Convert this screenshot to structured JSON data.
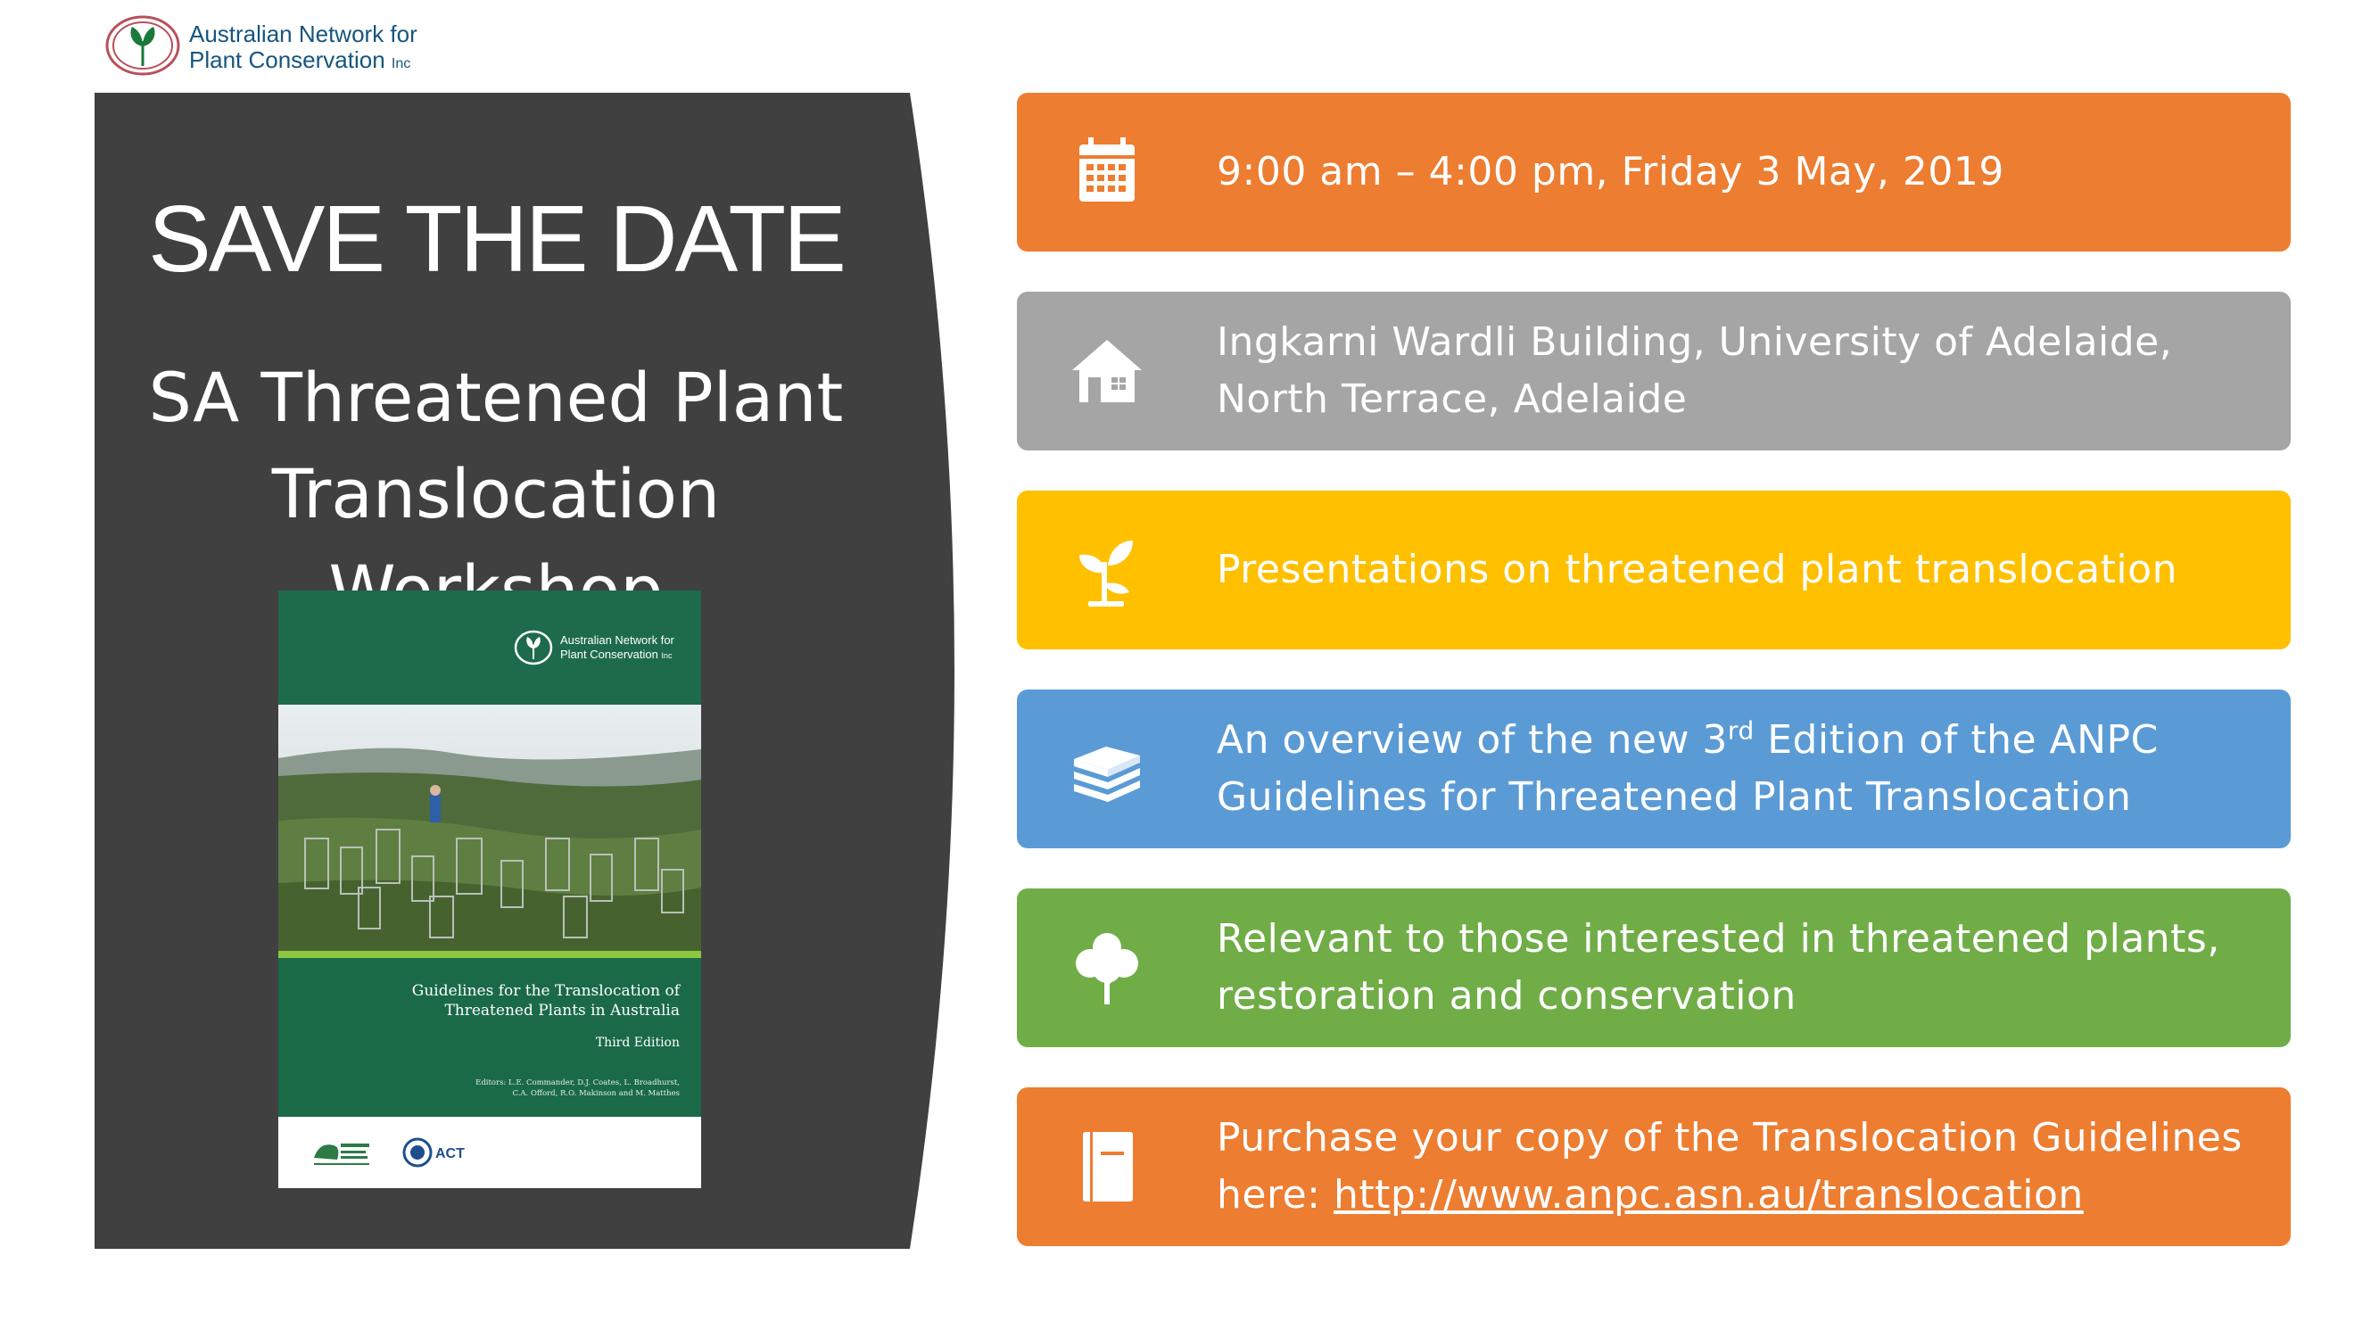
{
  "org_logo": {
    "line1": "Australian Network for",
    "line2": "Plant Conservation",
    "suffix": "Inc",
    "icon": "plant-leaf-icon"
  },
  "headline": "SAVE THE DATE",
  "event_title": "SA Threatened Plant Translocation Workshop",
  "book_cover": {
    "logo_line1": "Australian Network for",
    "logo_line2": "Plant Conservation",
    "logo_suffix": "Inc",
    "title_line1": "Guidelines for the Translocation of",
    "title_line2": "Threatened Plants in Australia",
    "edition": "Third Edition",
    "editors_line1": "Editors: L.E. Commander, D.J. Coates, L. Broadhurst,",
    "editors_line2": "C.A. Offord, R.O. Makinson and M. Matthes",
    "footer_logo2": "ACT"
  },
  "info_items": [
    {
      "id": "date",
      "icon": "calendar-icon",
      "color": "#ed7d31",
      "text": "9:00 am – 4:00 pm, Friday 3 May, 2019"
    },
    {
      "id": "venue",
      "icon": "home-icon",
      "color": "#a5a5a5",
      "text": "Ingkarni Wardli Building, University of Adelaide, North Terrace, Adelaide"
    },
    {
      "id": "presentations",
      "icon": "seedling-icon",
      "color": "#ffc000",
      "text": "Presentations on threatened plant translocation"
    },
    {
      "id": "overview",
      "icon": "books-icon",
      "color": "#5b9bd5",
      "text_before": "An overview of the new 3",
      "text_sup": "rd",
      "text_after": " Edition of the ANPC Guidelines for Threatened Plant Translocation"
    },
    {
      "id": "audience",
      "icon": "tree-icon",
      "color": "#70ad47",
      "text": "Relevant to those interested in threatened plants, restoration and conservation"
    },
    {
      "id": "purchase",
      "icon": "notebook-icon",
      "color": "#ed7d31",
      "text_before": "Purchase your copy of the Translocation Guidelines here: ",
      "link": "http://www.anpc.asn.au/translocation"
    }
  ],
  "colors": {
    "panel": "#404040",
    "orange": "#ed7d31",
    "grey": "#a5a5a5",
    "yellow": "#ffc000",
    "blue": "#5b9bd5",
    "green": "#70ad47",
    "cover_green": "#1c6e4a"
  }
}
